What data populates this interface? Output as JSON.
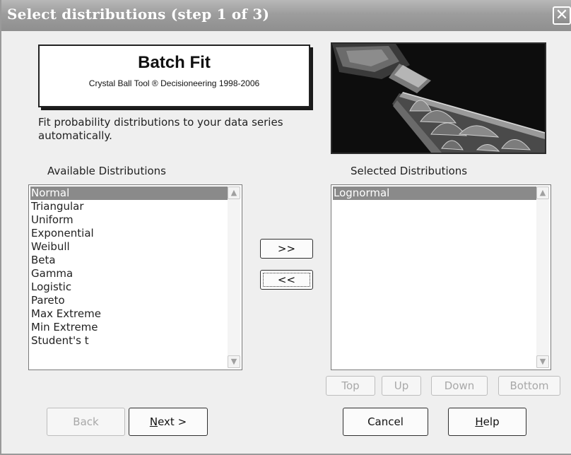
{
  "window": {
    "title": "Select distributions (step 1 of 3)",
    "close_glyph": "✕"
  },
  "logo": {
    "title": "Batch Fit",
    "subtitle": "Crystal Ball Tool ® Decisioneering 1998-2006"
  },
  "description": "Fit probability distributions to your data series automatically.",
  "available": {
    "label": "Available Distributions",
    "items": [
      "Normal",
      "Triangular",
      "Uniform",
      "Exponential",
      "Weibull",
      "Beta",
      "Gamma",
      "Logistic",
      "Pareto",
      "Max Extreme",
      "Min Extreme",
      "Student's t"
    ],
    "selected": "Normal"
  },
  "selected_list": {
    "label": "Selected Distributions",
    "items": [
      "Lognormal"
    ],
    "selected": "Lognormal"
  },
  "transfer": {
    "add": ">>",
    "remove": "<<"
  },
  "order_buttons": {
    "top": "Top",
    "up": "Up",
    "down": "Down",
    "bottom": "Bottom"
  },
  "nav": {
    "back": "Back",
    "next_mnemonic": "N",
    "next_rest": "ext >",
    "cancel": "Cancel",
    "help_mnemonic": "H",
    "help_rest": "elp"
  },
  "icons": {
    "scroll_up": "scroll-up-arrow-icon",
    "scroll_down": "scroll-down-arrow-icon",
    "close": "close-icon"
  },
  "colors": {
    "title_bar": "#9d9d9d",
    "selection": "#8a8a8a",
    "dialog_bg": "#efefef"
  }
}
